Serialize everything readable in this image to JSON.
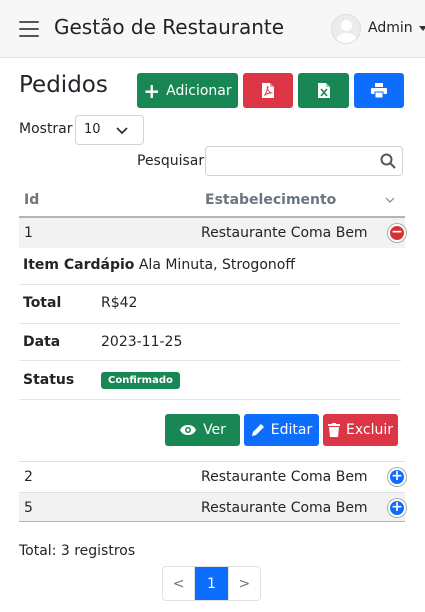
{
  "header": {
    "app_title": "Gestão de Restaurante",
    "user_name": "Admin"
  },
  "page": {
    "title": "Pedidos"
  },
  "toolbar": {
    "add_label": "Adicionar"
  },
  "controls": {
    "show_label": "Mostrar",
    "page_size": "10",
    "search_label": "Pesquisar",
    "search_value": ""
  },
  "table": {
    "headers": {
      "id": "Id",
      "establishment": "Estabelecimento"
    },
    "rows": [
      {
        "id": "1",
        "establishment": "Restaurante Coma Bem",
        "expanded": true
      },
      {
        "id": "2",
        "establishment": "Restaurante Coma Bem",
        "expanded": false
      },
      {
        "id": "5",
        "establishment": "Restaurante Coma Bem",
        "expanded": false
      }
    ]
  },
  "detail": {
    "item_label": "Item Cardápio",
    "item_value": "Ala Minuta, Strogonoff",
    "total_label": "Total",
    "total_value": "R$42",
    "date_label": "Data",
    "date_value": "2023-11-25",
    "status_label": "Status",
    "status_value": "Confirmado"
  },
  "actions": {
    "view_label": "Ver",
    "edit_label": "Editar",
    "delete_label": "Excluir"
  },
  "footer": {
    "total_text": "Total: 3 registros"
  },
  "pagination": {
    "prev": "<",
    "current": "1",
    "next": ">"
  },
  "colors": {
    "green": "#198754",
    "red": "#dc3545",
    "blue": "#0d6efd"
  }
}
